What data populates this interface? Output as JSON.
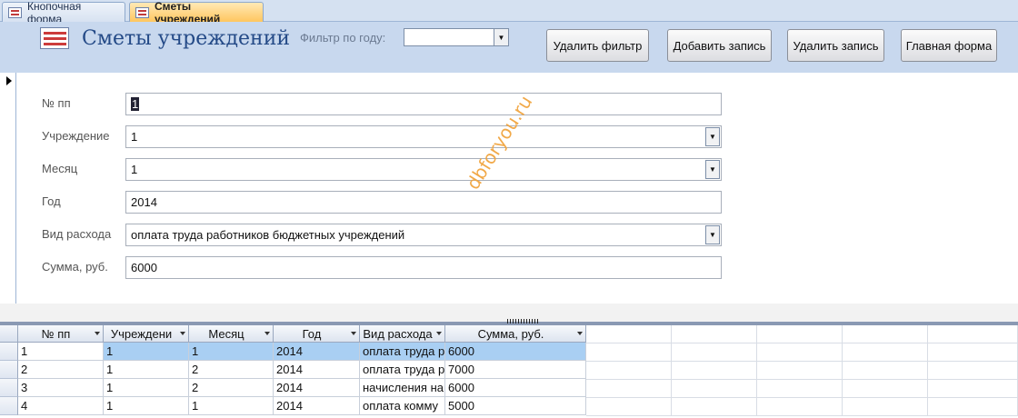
{
  "tabs": [
    {
      "label": "Кнопочная форма",
      "active": false
    },
    {
      "label": "Сметы учреждений",
      "active": true
    }
  ],
  "header": {
    "title": "Сметы учреждений",
    "filter_label": "Фильтр по году:",
    "filter_value": "",
    "buttons": {
      "remove_filter": "Удалить фильтр",
      "add_record": "Добавить запись",
      "delete_record": "Удалить запись",
      "main_form": "Главная форма"
    }
  },
  "fields": {
    "npp": {
      "label": "№ пп",
      "value": "1"
    },
    "institution": {
      "label": "Учреждение",
      "value": "1"
    },
    "month": {
      "label": "Месяц",
      "value": "1"
    },
    "year": {
      "label": "Год",
      "value": "2014"
    },
    "expense_type": {
      "label": "Вид расхода",
      "value": "оплата труда работников бюджетных учреждений"
    },
    "amount": {
      "label": "Сумма, руб.",
      "value": "6000"
    }
  },
  "watermark": "dbforyou.ru",
  "table": {
    "columns": [
      "№ пп",
      "Учреждени",
      "Месяц",
      "Год",
      "Вид расхода",
      "Сумма, руб."
    ],
    "rows": [
      [
        "1",
        "1",
        "1",
        "2014",
        "оплата труда р",
        "6000"
      ],
      [
        "2",
        "1",
        "2",
        "2014",
        "оплата труда р",
        "7000"
      ],
      [
        "3",
        "1",
        "2",
        "2014",
        "начисления на",
        "6000"
      ],
      [
        "4",
        "1",
        "1",
        "2014",
        "оплата комму",
        "5000"
      ]
    ],
    "selected_row": 0
  },
  "colors": {
    "header_bg": "#c8d8ee",
    "active_tab": "#ffc65f",
    "selected_row": "#a9cff3",
    "title_text": "#244a87",
    "watermark": "#f0a23a"
  }
}
